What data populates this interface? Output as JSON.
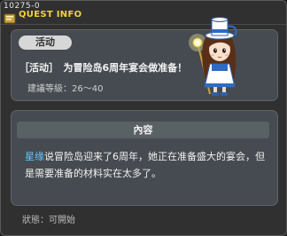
{
  "window": {
    "quest_id": "10275-0",
    "title": "QUEST INFO"
  },
  "quest": {
    "tag": "活动",
    "name": "［活动］　为冒险岛6周年宴会做准备！",
    "level_label": "建議等級：",
    "level_range": "26～40",
    "section_title": "內容",
    "desc_highlight": "星缘",
    "desc_text": "说冒险岛迎来了6周年，她正在准备盛大的宴会，但是需要准备的材料实在太多了。",
    "status_label": "狀態：",
    "status_value": "可開始"
  },
  "colors": {
    "title": "#f2d23c",
    "highlight": "#66c7ff",
    "panel": "#454b50"
  }
}
